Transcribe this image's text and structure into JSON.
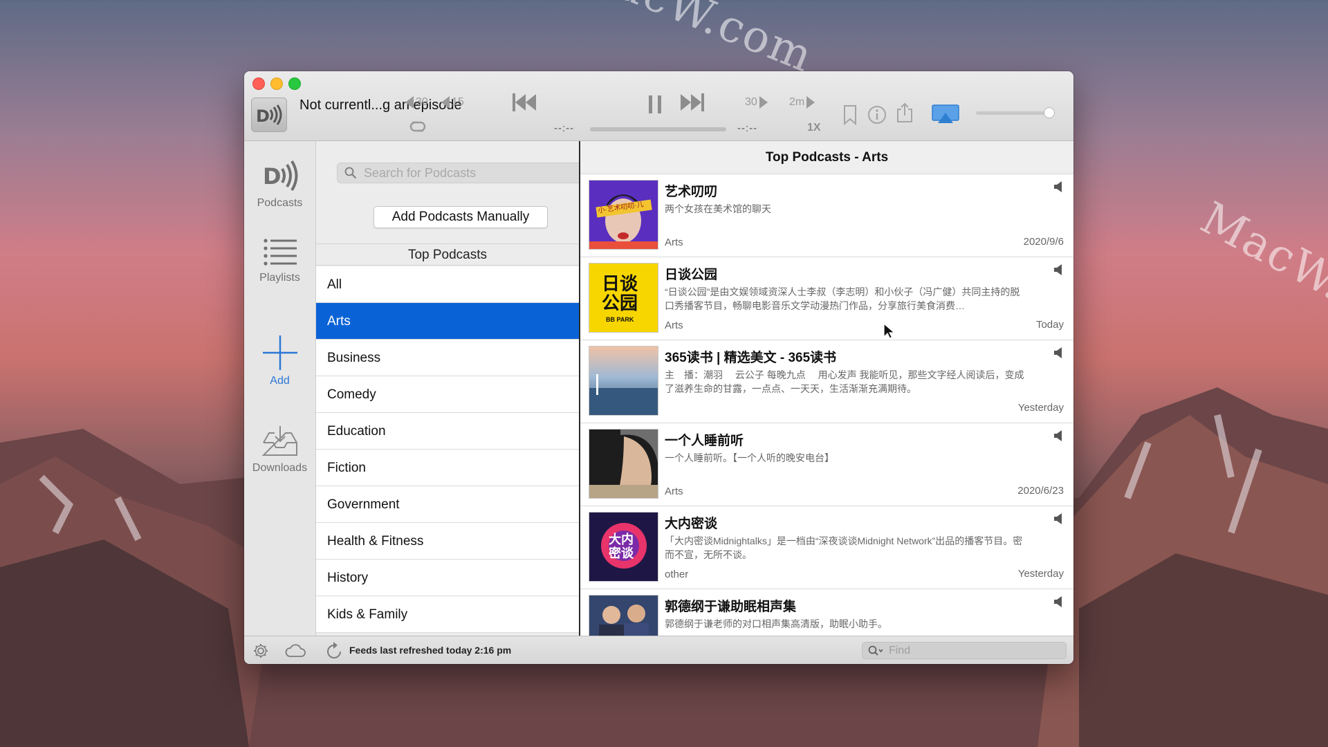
{
  "window": {
    "now_playing": "Not currentl...g an episode"
  },
  "transport": {
    "back30_label": "30",
    "back15_label": "15",
    "fwd30_label": "30",
    "fwd2m_label": "2m",
    "elapsed": "--:--",
    "remaining": "--:--",
    "speed": "1X"
  },
  "sidebar": {
    "items": [
      {
        "label": "Podcasts",
        "icon": "podcast-icon"
      },
      {
        "label": "Playlists",
        "icon": "list-icon"
      },
      {
        "label": "Add",
        "icon": "plus-icon"
      },
      {
        "label": "Downloads",
        "icon": "download-tray-icon"
      }
    ]
  },
  "middle": {
    "search_placeholder": "Search for Podcasts",
    "add_manually_label": "Add Podcasts Manually",
    "top_header": "Top Podcasts",
    "categories": [
      "All",
      "Arts",
      "Business",
      "Comedy",
      "Education",
      "Fiction",
      "Government",
      "Health & Fitness",
      "History",
      "Kids & Family"
    ],
    "selected_category": "Arts"
  },
  "right": {
    "header": "Top Podcasts - Arts",
    "podcasts": [
      {
        "title": "艺术叨叨",
        "desc": "两个女孩在美术馆的聊天",
        "category": "Arts",
        "date": "2020/9/6"
      },
      {
        "title": "日谈公园",
        "desc": "“日谈公园”是由文娱领域资深人士李叔（李志明）和小伙子（冯广健）共同主持的脱口秀播客节目，畅聊电影音乐文学动漫热门作品，分享旅行美食消费…",
        "category": "Arts",
        "date": "Today"
      },
      {
        "title": "365读书 | 精选美文 - 365读书",
        "desc": "主　播：潮羽　 云公子 每晚九点　 用心发声 我能听见，那些文字经人阅读后，变成了滋养生命的甘露，一点点、一天天，生活渐渐充满期待。",
        "category": "",
        "date": "Yesterday"
      },
      {
        "title": "一个人睡前听",
        "desc": "一个人睡前听。【一个人听的晚安电台】",
        "category": "Arts",
        "date": "2020/6/23"
      },
      {
        "title": "大内密谈",
        "desc": "「大内密谈Midnightalks」是一档由“深夜谈谈Midnight Network”出品的播客节目。密而不宣，无所不谈。",
        "category": "other",
        "date": "Yesterday"
      },
      {
        "title": "郭德纲于谦助眠相声集",
        "desc": "郭德纲于谦老师的对口相声集高清版，助眠小助手。",
        "category": "",
        "date": ""
      }
    ],
    "thumb_texts": {
      "p1_banner": "小·艺术叨叨·儿",
      "p2_line1": "日谈",
      "p2_line2": "公园",
      "p2_sub": "BB PARK",
      "p5_logo": "大内\n密谈"
    }
  },
  "bottom": {
    "status": "Feeds last refreshed today 2:16 pm",
    "find_placeholder": "Find"
  },
  "watermark": "MacW.com",
  "colors": {
    "accent": "#0a63d6",
    "add_blue": "#2c78d6"
  }
}
